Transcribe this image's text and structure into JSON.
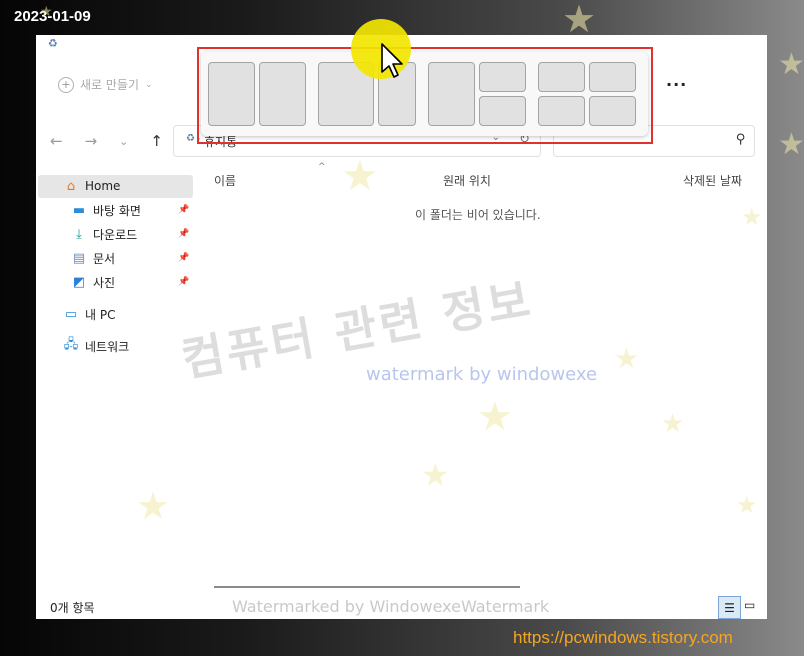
{
  "overlay": {
    "date": "2023-01-09",
    "url": "https://pcwindows.tistory.com"
  },
  "toolbar": {
    "new_label": "새로 만들기",
    "more_label": "···",
    "new_icon": "plus-circle-icon",
    "chevron_icon": "chevron-right-icon"
  },
  "address": {
    "path": "휴지통",
    "icon": "recycle-bin-icon"
  },
  "sidebar": {
    "items": [
      {
        "label": "Home",
        "icon": "home-icon"
      },
      {
        "label": "바탕 화면",
        "icon": "desktop-icon"
      },
      {
        "label": "다운로드",
        "icon": "download-icon"
      },
      {
        "label": "문서",
        "icon": "document-icon"
      },
      {
        "label": "사진",
        "icon": "pictures-icon"
      },
      {
        "label": "내 PC",
        "icon": "monitor-icon"
      },
      {
        "label": "네트워크",
        "icon": "network-icon"
      }
    ]
  },
  "columns": [
    "이름",
    "원래 위치",
    "삭제된 날짜"
  ],
  "empty_message": "이 폴더는 비어 있습니다.",
  "status": {
    "item_count": "0개 항목"
  },
  "watermarks": {
    "korean": "컴퓨터 관련 정보",
    "english": "watermark by windowexe",
    "bottom": "Watermarked by WindowexeWatermark"
  },
  "snap_layouts": {
    "layouts": [
      "two-columns-equal",
      "two-columns-wide-left",
      "main-plus-two-stacked",
      "four-quadrants"
    ]
  },
  "colors": {
    "snap_border": "#e03030",
    "cursor_highlight": "#f2e600",
    "url": "#f5a623"
  }
}
